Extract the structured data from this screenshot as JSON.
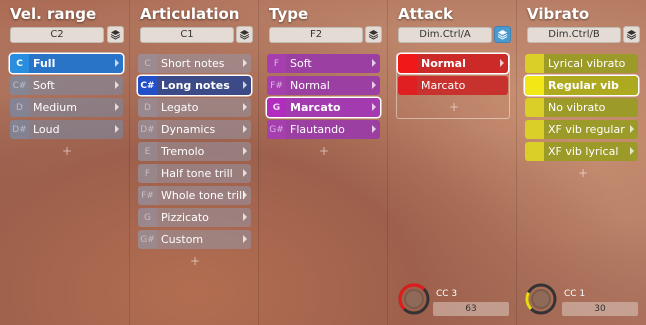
{
  "columns": {
    "vel": {
      "title": "Vel. range",
      "selector": "C2",
      "items": [
        {
          "key": "C",
          "label": "Full"
        },
        {
          "key": "C#",
          "label": "Soft"
        },
        {
          "key": "D",
          "label": "Medium"
        },
        {
          "key": "D#",
          "label": "Loud"
        }
      ]
    },
    "art": {
      "title": "Articulation",
      "selector": "C1",
      "items": [
        {
          "key": "C",
          "label": "Short notes"
        },
        {
          "key": "C#",
          "label": "Long notes"
        },
        {
          "key": "D",
          "label": "Legato"
        },
        {
          "key": "D#",
          "label": "Dynamics"
        },
        {
          "key": "E",
          "label": "Tremolo"
        },
        {
          "key": "F",
          "label": "Half tone trill"
        },
        {
          "key": "F#",
          "label": "Whole tone trill"
        },
        {
          "key": "G",
          "label": "Pizzicato"
        },
        {
          "key": "G#",
          "label": "Custom"
        }
      ]
    },
    "type": {
      "title": "Type",
      "selector": "F2",
      "items": [
        {
          "key": "F",
          "label": "Soft"
        },
        {
          "key": "F#",
          "label": "Normal"
        },
        {
          "key": "G",
          "label": "Marcato"
        },
        {
          "key": "G#",
          "label": "Flautando"
        }
      ]
    },
    "attack": {
      "title": "Attack",
      "selector": "Dim.Ctrl/A",
      "items": [
        {
          "key": "",
          "label": "Normal"
        },
        {
          "key": "",
          "label": "Marcato"
        }
      ],
      "cc_label": "CC 3",
      "cc_value": "63",
      "knob_level": 0.5
    },
    "vibrato": {
      "title": "Vibrato",
      "selector": "Dim.Ctrl/B",
      "items": [
        {
          "key": "",
          "label": "Lyrical vibrato"
        },
        {
          "key": "",
          "label": "Regular vib"
        },
        {
          "key": "",
          "label": "No vibrato"
        },
        {
          "key": "",
          "label": "XF vib regular"
        },
        {
          "key": "",
          "label": "XF vib lyrical"
        }
      ],
      "cc_label": "CC 1",
      "cc_value": "30",
      "knob_level": 0.24
    }
  },
  "add_glyph": "+",
  "colors": {
    "selected_blue": "#2a8ee0",
    "selected_navy": "#2350c8",
    "type_purple": "#b22dbf",
    "attack_red": "#f01818",
    "vibrato_yellow": "#f2e816",
    "stack_active": "#4a9ad2"
  }
}
